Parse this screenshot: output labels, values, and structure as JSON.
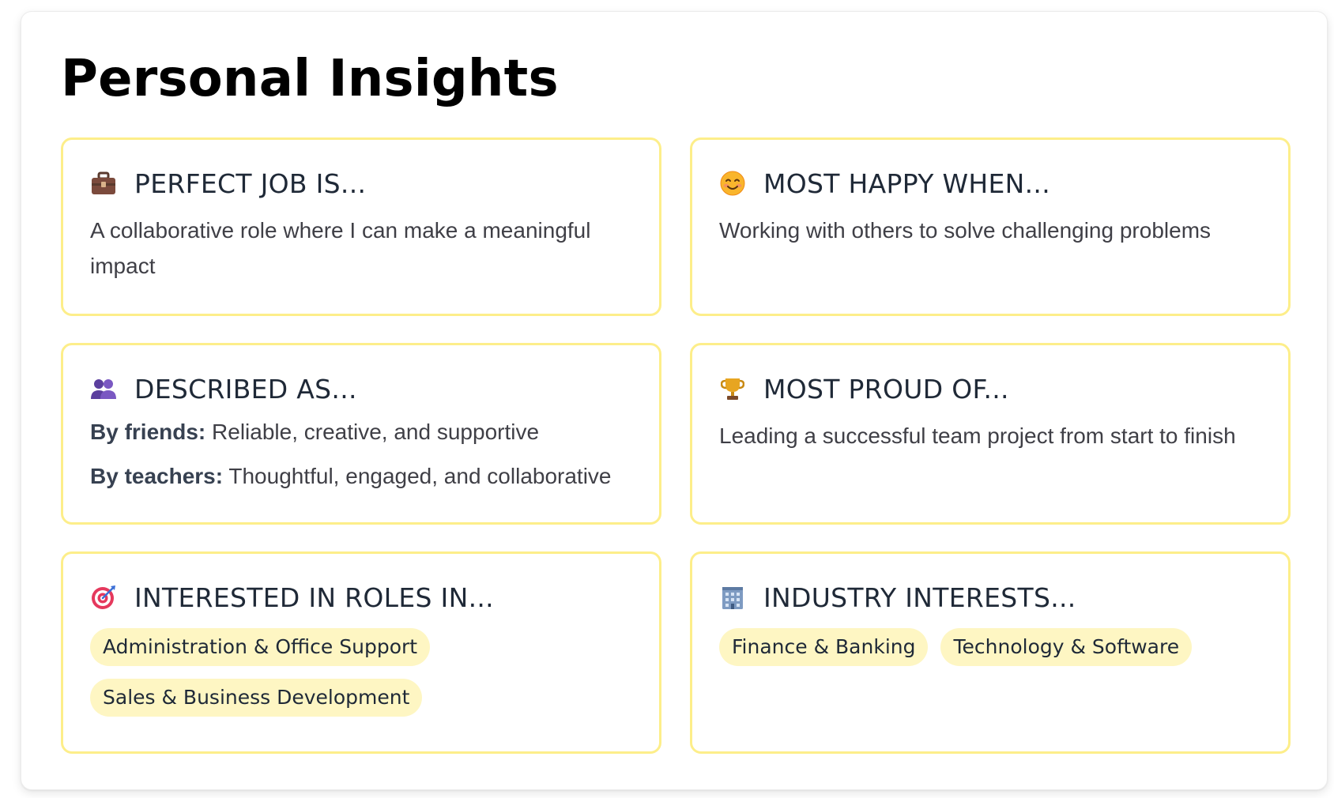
{
  "page": {
    "title": "Personal Insights"
  },
  "cards": {
    "perfect_job": {
      "icon": "briefcase-icon",
      "title": "PERFECT JOB IS...",
      "text": "A collaborative role where I can make a meaningful impact"
    },
    "most_happy": {
      "icon": "smiling-face-icon",
      "title": "MOST HAPPY WHEN...",
      "text": "Working with others to solve challenging problems"
    },
    "described_as": {
      "icon": "people-icon",
      "title": "DESCRIBED AS...",
      "friends_label": "By friends:",
      "friends_text": " Reliable, creative, and supportive",
      "teachers_label": "By teachers:",
      "teachers_text": " Thoughtful, engaged, and collaborative"
    },
    "most_proud": {
      "icon": "trophy-icon",
      "title": "MOST PROUD OF...",
      "text": "Leading a successful team project from start to finish"
    },
    "roles": {
      "icon": "target-icon",
      "title": "INTERESTED IN ROLES IN...",
      "tags": [
        "Administration & Office Support",
        "Sales & Business Development"
      ]
    },
    "industry": {
      "icon": "office-building-icon",
      "title": "INDUSTRY INTERESTS...",
      "tags": [
        "Finance & Banking",
        "Technology & Software"
      ]
    }
  },
  "colors": {
    "card_border": "#fdee8a",
    "tag_background": "#fef6c3",
    "title": "#000000",
    "text": "#3f3f46"
  }
}
